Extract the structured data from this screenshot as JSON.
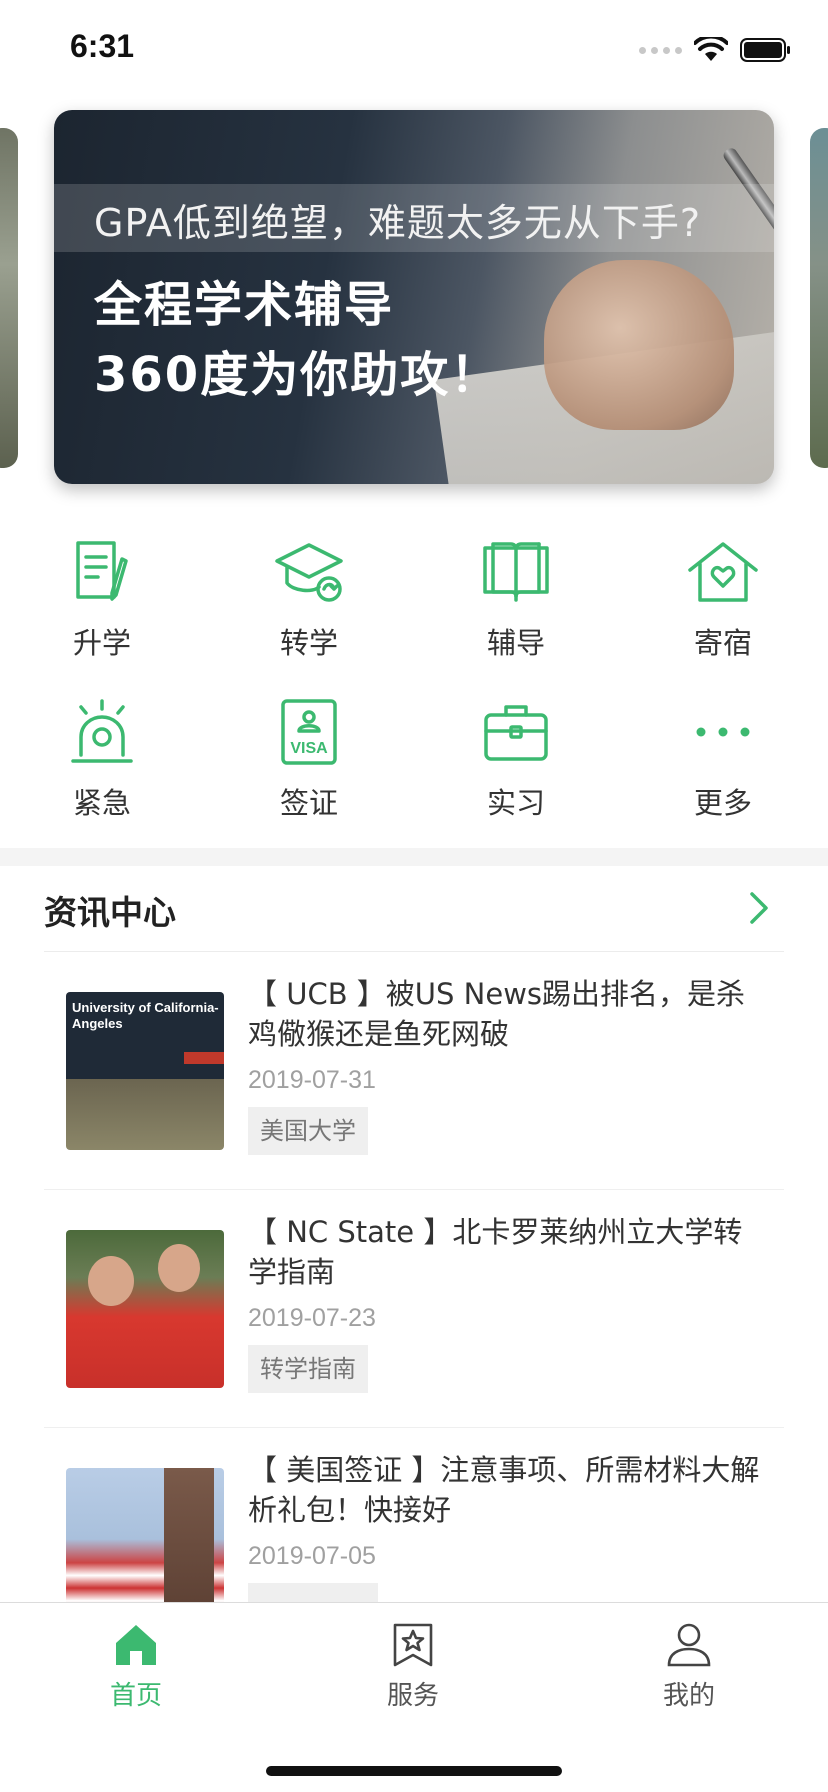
{
  "status_bar": {
    "time": "6:31"
  },
  "banner": {
    "subtitle": "GPA低到绝望，难题太多无从下手?",
    "title_line1": "全程学术辅导",
    "title_line2": "360度为你助攻！"
  },
  "services": [
    {
      "label": "升学",
      "icon": "document-icon"
    },
    {
      "label": "转学",
      "icon": "graduation-cap-icon"
    },
    {
      "label": "辅导",
      "icon": "book-icon"
    },
    {
      "label": "寄宿",
      "icon": "house-heart-icon"
    },
    {
      "label": "紧急",
      "icon": "alarm-light-icon"
    },
    {
      "label": "签证",
      "icon": "visa-icon"
    },
    {
      "label": "实习",
      "icon": "briefcase-icon"
    },
    {
      "label": "更多",
      "icon": "more-dots-icon"
    }
  ],
  "news": {
    "title": "资讯中心",
    "items": [
      {
        "title": "【 UCB 】被US News踢出排名，是杀鸡儆猴还是鱼死网破",
        "date": "2019-07-31",
        "tag": "美国大学",
        "thumb_text": "University of California-Angeles"
      },
      {
        "title": "【 NC State 】北卡罗莱纳州立大学转学指南",
        "date": "2019-07-23",
        "tag": "转学指南"
      },
      {
        "title": "【 美国签证 】注意事项、所需材料大解析礼包！快接好",
        "date": "2019-07-05",
        "tag": ""
      }
    ]
  },
  "tabs": [
    {
      "label": "首页",
      "icon": "home-icon",
      "active": true
    },
    {
      "label": "服务",
      "icon": "star-bookmark-icon",
      "active": false
    },
    {
      "label": "我的",
      "icon": "user-icon",
      "active": false
    }
  ],
  "colors": {
    "accent": "#3cb970",
    "text": "#333333",
    "muted": "#a0a0a0"
  }
}
